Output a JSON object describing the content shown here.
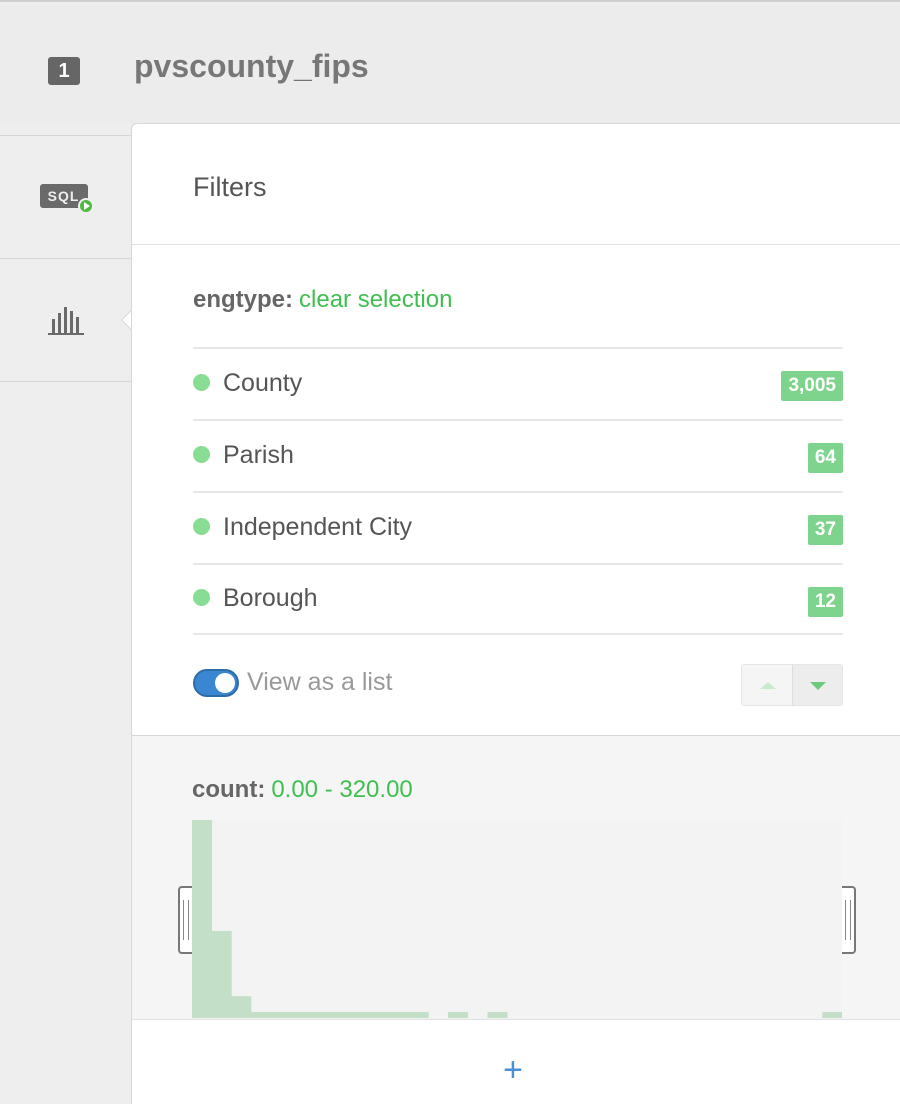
{
  "layer": {
    "number": "1",
    "title": "pvscounty_fips"
  },
  "sidebar": {
    "items": [
      {
        "name": "sql",
        "icon": "sql-run-icon",
        "label": "SQL"
      },
      {
        "name": "widgets",
        "icon": "bar-chart-icon"
      }
    ]
  },
  "panel": {
    "title": "Filters",
    "category_filter": {
      "column": "engtype:",
      "clear_label": "clear selection",
      "items": [
        {
          "label": "County",
          "count": "3,005"
        },
        {
          "label": "Parish",
          "count": "64"
        },
        {
          "label": "Independent City",
          "count": "37"
        },
        {
          "label": "Borough",
          "count": "12"
        }
      ],
      "view_as_list_label": "View as a list",
      "view_as_list_on": true
    },
    "histogram_filter": {
      "column": "count:",
      "range": "0.00 - 320.00"
    }
  },
  "chart_data": {
    "type": "bar",
    "title": "",
    "xlabel": "",
    "ylabel": "",
    "xlim": [
      0,
      320
    ],
    "values": [
      100,
      44,
      11,
      3,
      3,
      3,
      3,
      3,
      3,
      3,
      3,
      3,
      0,
      3,
      0,
      3,
      0,
      0,
      0,
      0,
      0,
      0,
      0,
      0,
      0,
      0,
      0,
      0,
      0,
      0,
      0,
      0,
      3
    ],
    "ylim": [
      0,
      100
    ],
    "bar_color": "#c3dfc7",
    "grid": false
  },
  "footer": {
    "add_label": "+"
  },
  "colors": {
    "accent_green": "#3fbf4f",
    "badge_green": "#7ed48c",
    "toggle_blue": "#3b86d1"
  }
}
